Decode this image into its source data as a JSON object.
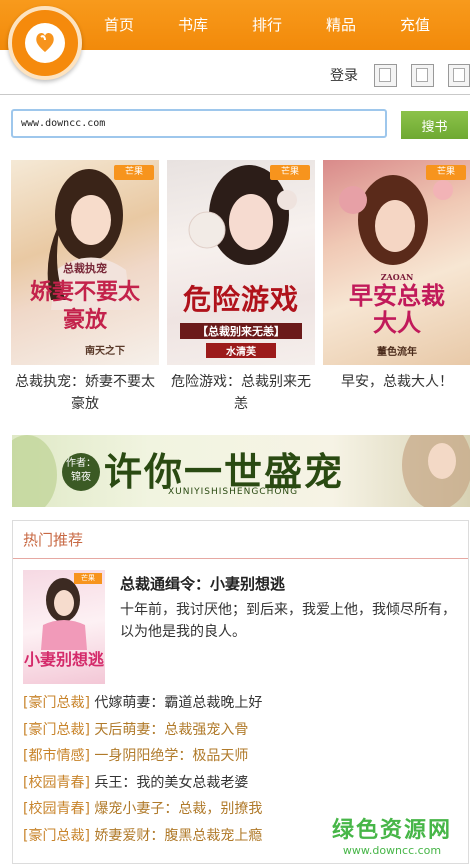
{
  "nav": {
    "items": [
      "首页",
      "书库",
      "排行",
      "精品",
      "充值"
    ]
  },
  "header": {
    "login_label": "登录"
  },
  "search": {
    "value": "www.downcc.com",
    "button_label": "搜书"
  },
  "books": [
    {
      "title": "总裁执宠：娇妻不要太豪放",
      "cover_title": "娇妻不要太豪放",
      "cover_sub": "总裁执宠",
      "cover_author": "南天之下",
      "badge": "芒果"
    },
    {
      "title": "危险游戏：总裁别来无恙",
      "cover_title": "危险游戏",
      "cover_sub": "【总裁别来无恙】",
      "cover_author": "水清芙",
      "badge": "芒果"
    },
    {
      "title": "早安，总裁大人！",
      "cover_title": "早安总裁大人",
      "cover_sub": "ZAOAN",
      "cover_author": "董色流年",
      "badge": "芒果"
    }
  ],
  "banner": {
    "author_label": "作者：",
    "author_name": "锦夜",
    "title": "许你一世盛宠",
    "pinyin": "XUNIYISHISHENGCHONG"
  },
  "hot": {
    "heading": "热门推荐",
    "feature": {
      "title": "总裁通缉令：小妻别想逃",
      "desc": "十年前，我讨厌他；到后来，我爱上他，我倾尽所有，以为他是我的良人。",
      "cover_title": "小妻别想逃",
      "badge": "芒果"
    },
    "list": [
      {
        "category": "[豪门总裁]",
        "title": "代嫁萌妻：霸道总裁晚上好"
      },
      {
        "category": "[豪门总裁]",
        "title": "天后萌妻：总裁强宠入骨"
      },
      {
        "category": "[都市情感]",
        "title": "一身阴阳绝学：极品天师"
      },
      {
        "category": "[校园青春]",
        "title": "兵王：我的美女总裁老婆"
      },
      {
        "category": "[校园青春]",
        "title": "爆宠小妻子：总裁，别撩我"
      },
      {
        "category": "[豪门总裁]",
        "title": "娇妻爱财：腹黑总裁宠上瘾"
      }
    ]
  },
  "watermark": {
    "line1": "绿色资源网",
    "line2": "www.downcc.com"
  }
}
